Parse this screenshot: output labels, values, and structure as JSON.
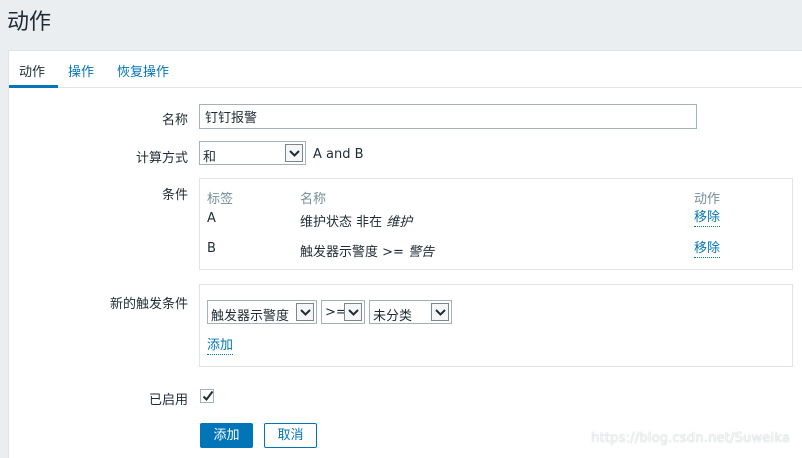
{
  "page": {
    "title": "动作"
  },
  "tabs": [
    {
      "label": "动作",
      "active": true
    },
    {
      "label": "操作",
      "active": false
    },
    {
      "label": "恢复操作",
      "active": false
    }
  ],
  "form": {
    "name": {
      "label": "名称",
      "value": "钉钉报警"
    },
    "calc": {
      "label": "计算方式",
      "selected": "和",
      "formula": "A and B"
    },
    "conditions": {
      "label": "条件",
      "headers": {
        "tag": "标签",
        "name": "名称",
        "action": "动作"
      },
      "rows": [
        {
          "tag": "A",
          "prefix": "维护状态 非在 ",
          "value": "维护",
          "action": "移除"
        },
        {
          "tag": "B",
          "prefix": "触发器示警度 >= ",
          "value": "警告",
          "action": "移除"
        }
      ]
    },
    "new_condition": {
      "label": "新的触发条件",
      "field": "触发器示警度",
      "operator": ">=",
      "value": "未分类",
      "add_link": "添加"
    },
    "enabled": {
      "label": "已启用",
      "checked": true
    }
  },
  "buttons": {
    "add": "添加",
    "cancel": "取消"
  },
  "watermark": "https://blog.csdn.net/Suweika"
}
